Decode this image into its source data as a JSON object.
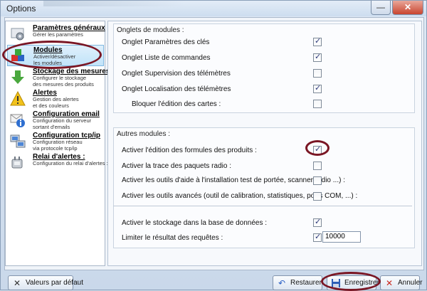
{
  "window": {
    "title": "Options",
    "minimize_glyph": "—",
    "close_glyph": "✕"
  },
  "menu": {
    "items": [
      {
        "title": "Paramètres généraux",
        "desc1": "Gérer les paramètres",
        "desc2": "",
        "icon": "settings-gear-icon"
      },
      {
        "title": "Modules",
        "desc1": "Activer/désactiver",
        "desc2": "les modules",
        "icon": "modules-blocks-icon"
      },
      {
        "title": "Stockage des mesures",
        "desc1": "Configurer le stockage",
        "desc2": "des mesures des produits",
        "icon": "download-storage-icon"
      },
      {
        "title": "Alertes",
        "desc1": "Gestion des alertes",
        "desc2": "et des couleurs",
        "icon": "warning-icon"
      },
      {
        "title": "Configuration email",
        "desc1": "Configuration du serveur",
        "desc2": "sortant d'emails",
        "icon": "email-info-icon"
      },
      {
        "title": "Configuration tcp/ip",
        "desc1": "Configuration réseau",
        "desc2": "via protocole tcp/ip",
        "icon": "network-icon"
      },
      {
        "title": "Relai d'alertes :",
        "desc1": "Configuration du relai d'alertes :",
        "desc2": "",
        "icon": "relay-icon"
      }
    ]
  },
  "onglets": {
    "title": "Onglets de modules :",
    "rows": [
      {
        "label": "Onglet Paramètres des clés",
        "checked": true
      },
      {
        "label": "Onglet Liste de commandes",
        "checked": true
      },
      {
        "label": "Onglet Supervision des télémètres",
        "checked": false
      },
      {
        "label": "Onglet Localisation des télémètres",
        "checked": true
      },
      {
        "label": "Bloquer l'édition des cartes :",
        "checked": false
      }
    ]
  },
  "autres": {
    "title": "Autres modules :",
    "rows": [
      {
        "label": "Activer l'édition des formules des produits :",
        "checked": true
      },
      {
        "label": "Activer la trace des paquets radio :",
        "checked": false
      },
      {
        "label": "Activer les outils d'aide à l'installation test de portée, scanner radio ...) :",
        "checked": false
      },
      {
        "label": "Activer les outils avancés (outil de calibration, statistiques, ports COM, ...) :",
        "checked": false
      },
      {
        "label": "Activer le stockage dans la base de données :",
        "checked": true
      },
      {
        "label": "Limiter le résultat des requêtes :",
        "checked": true
      }
    ],
    "limit_value": "10000"
  },
  "buttons": {
    "defaults": {
      "label": "Valeurs par défaut",
      "icon": "x-icon"
    },
    "restore": {
      "label": "Restaurer",
      "icon": "undo-icon"
    },
    "save": {
      "label": "Enregistrer",
      "icon": "floppy-disk-icon"
    },
    "cancel": {
      "label": "Annuler",
      "icon": "red-x-icon"
    }
  },
  "colors": {
    "highlight_oval": "#7a1624",
    "selected_item": "#c1e3f9"
  }
}
